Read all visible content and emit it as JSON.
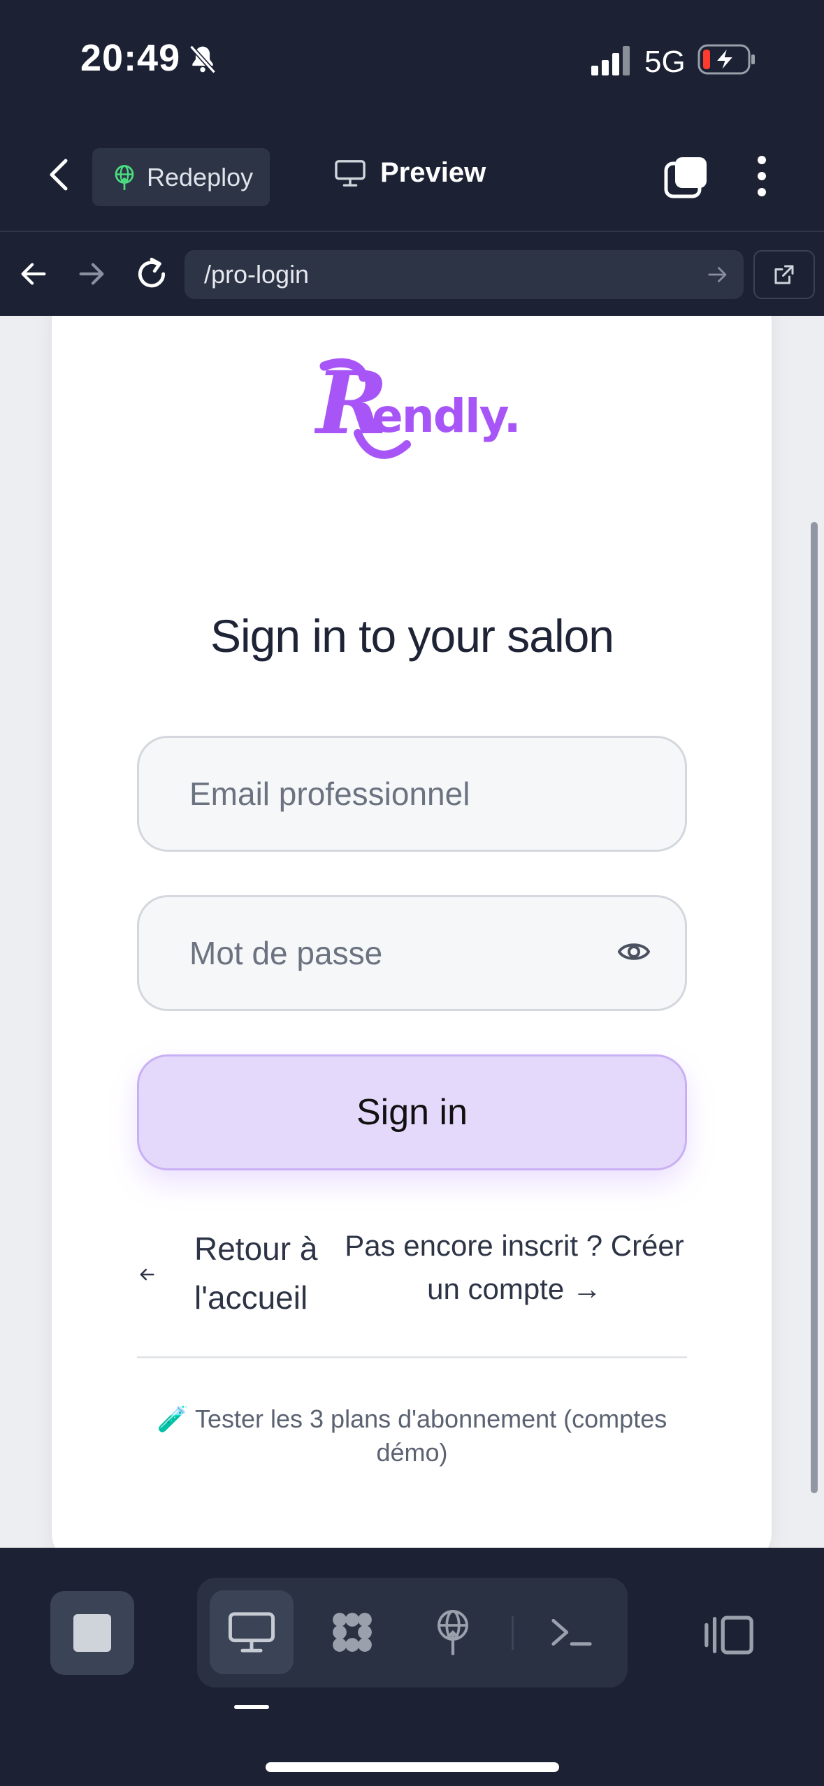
{
  "status_bar": {
    "time": "20:49",
    "network": "5G"
  },
  "header": {
    "redeploy_label": "Redeploy",
    "preview_label": "Preview"
  },
  "browser": {
    "url": "/pro-login"
  },
  "brand": {
    "logo_text": "Rendly.",
    "accent_color": "#a855f7"
  },
  "login": {
    "title": "Sign in to your salon",
    "email_placeholder": "Email professionnel",
    "password_placeholder": "Mot de passe",
    "signin_label": "Sign in",
    "back_home": "Retour à l'accueil",
    "create_account": "Pas encore inscrit ? Créer un compte →",
    "test_plans_emoji": "🧪",
    "test_plans": "Tester les 3 plans d'abonnement (comptes démo)"
  },
  "icons": [
    "bell-off-icon",
    "signal-icon",
    "battery-charging-icon",
    "chevron-left-icon",
    "globe-icon",
    "monitor-icon",
    "tabs-icon",
    "more-vertical-icon",
    "arrow-left-icon",
    "arrow-right-icon",
    "reload-icon",
    "external-link-icon",
    "eye-icon",
    "stop-icon",
    "apps-icon",
    "deploy-icon",
    "terminal-icon",
    "side-panel-icon"
  ]
}
